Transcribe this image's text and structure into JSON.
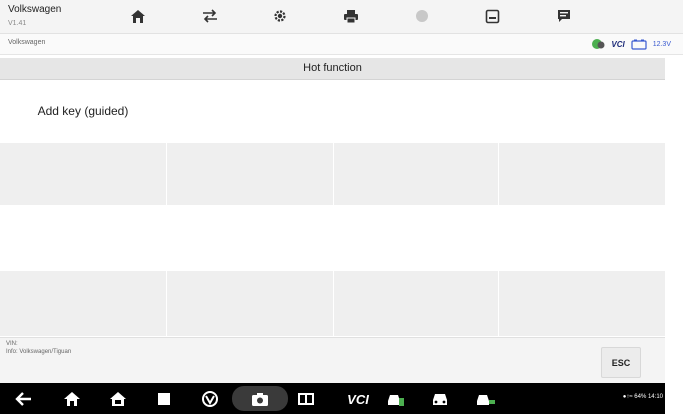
{
  "app": {
    "title": "Volkswagen",
    "version": "V1.41"
  },
  "toolbar": {
    "icons": [
      "home-icon",
      "vehicle-swap-icon",
      "settings-icon",
      "print-icon",
      "help-icon",
      "save-icon",
      "data-log-icon"
    ]
  },
  "breadcrumb": {
    "text": "Volkswagen"
  },
  "status": {
    "vci_label": "VCI",
    "voltage": "12.3V"
  },
  "section": {
    "title": "Hot function"
  },
  "functions": [
    {
      "label": "Add key (guided)"
    }
  ],
  "info": {
    "vin": "VIN:",
    "info_text": "Info: Volkswagen/Tiguan"
  },
  "esc_label": "ESC",
  "navbar": {
    "vci_label": "VCI",
    "status_text": "64% 14:10",
    "icons": [
      "back-icon",
      "home-icon",
      "desktop-icon",
      "recent-apps-icon",
      "browser-icon",
      "camera-icon",
      "screen-mirror-icon",
      "vci-icon",
      "car-remote-icon",
      "car-icon",
      "car-service-icon"
    ]
  },
  "colors": {
    "accent_blue": "#1f2d7a",
    "voltage_blue": "#3a5ad0",
    "status_green": "#4caf50",
    "nav_bg": "#000000"
  }
}
